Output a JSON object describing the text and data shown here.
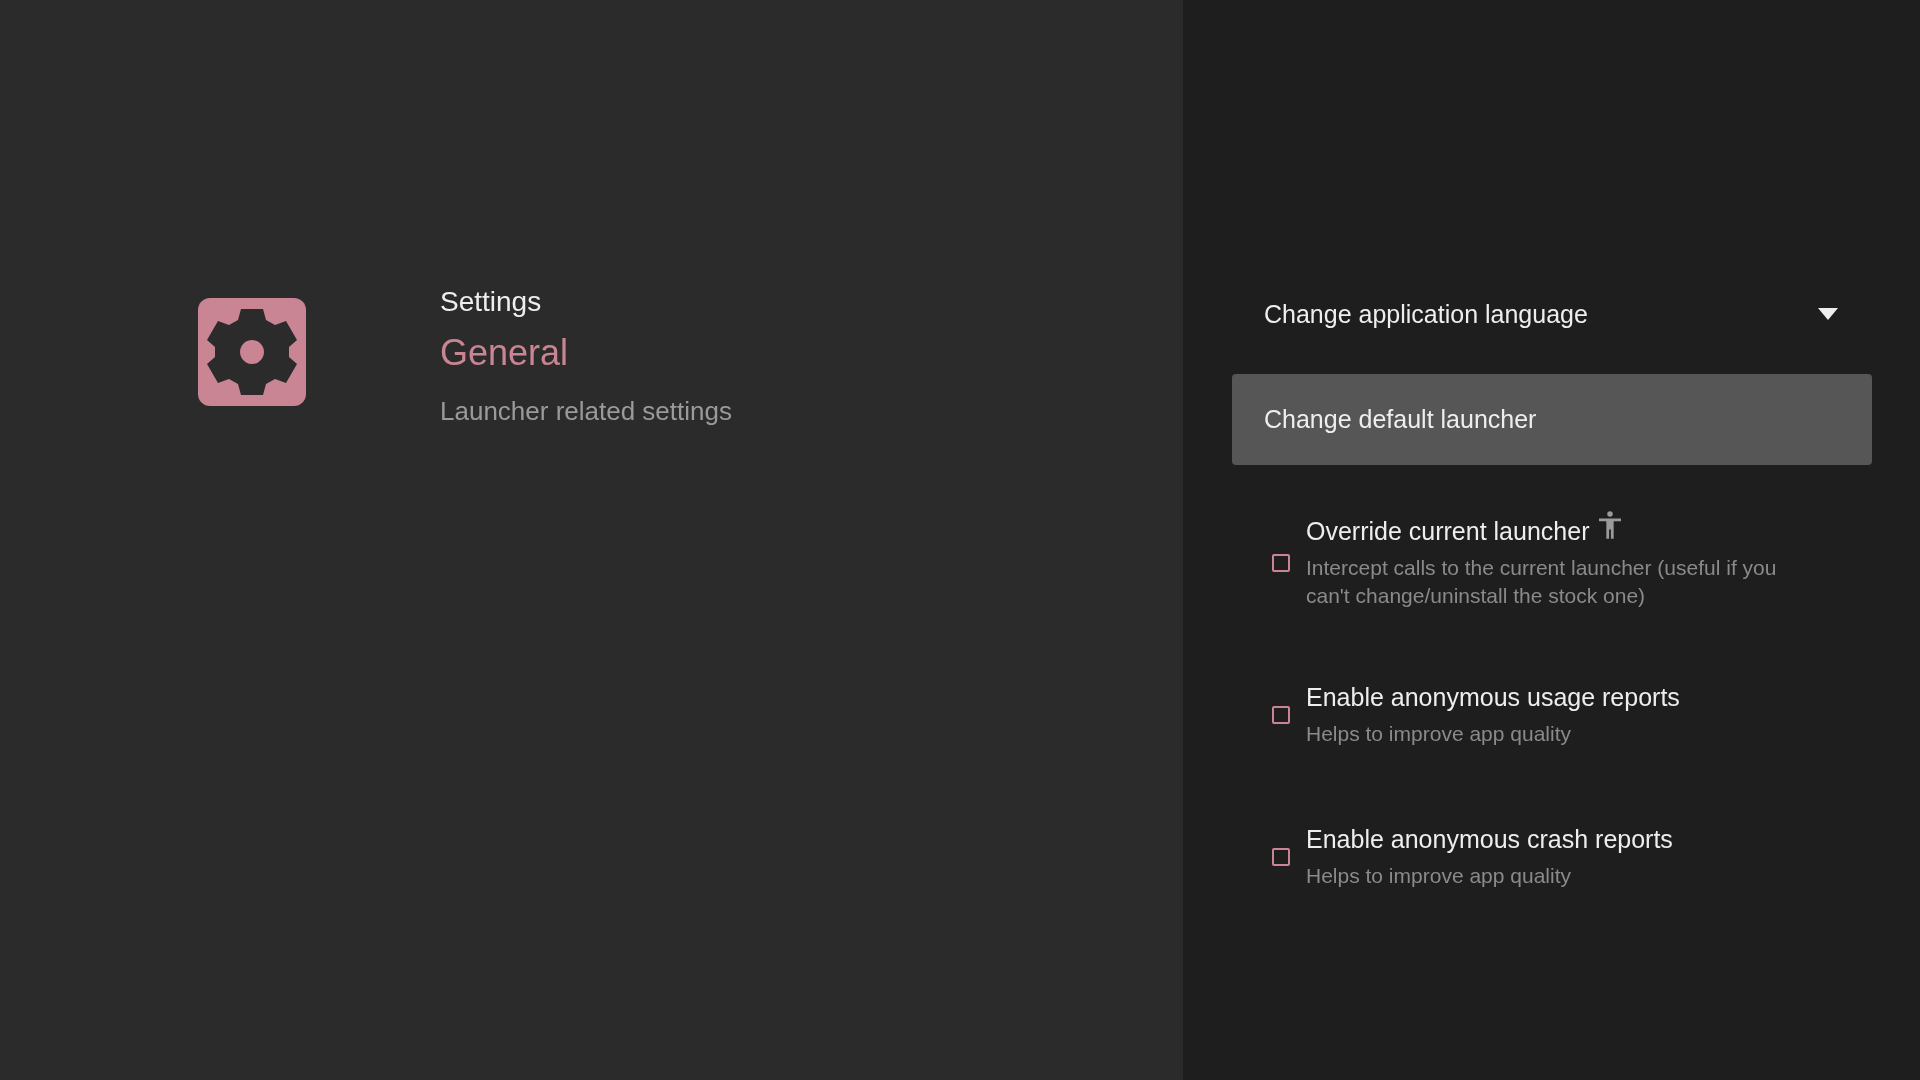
{
  "header": {
    "title": "Settings",
    "section": "General",
    "subtitle": "Launcher related settings"
  },
  "items": [
    {
      "kind": "dropdown",
      "label": "Change application language",
      "selected": false
    },
    {
      "kind": "action",
      "label": "Change default launcher",
      "selected": true
    },
    {
      "kind": "checkbox",
      "label": "Override current launcher",
      "accessibility_icon": true,
      "description": "Intercept calls to the current launcher (useful if you can't change/uninstall the stock one)",
      "checked": false,
      "selected": false
    },
    {
      "kind": "checkbox",
      "label": "Enable anonymous usage reports",
      "description": "Helps to improve app quality",
      "checked": false,
      "selected": false
    },
    {
      "kind": "checkbox",
      "label": "Enable anonymous crash reports",
      "description": "Helps to improve app quality",
      "checked": false,
      "selected": false
    }
  ]
}
